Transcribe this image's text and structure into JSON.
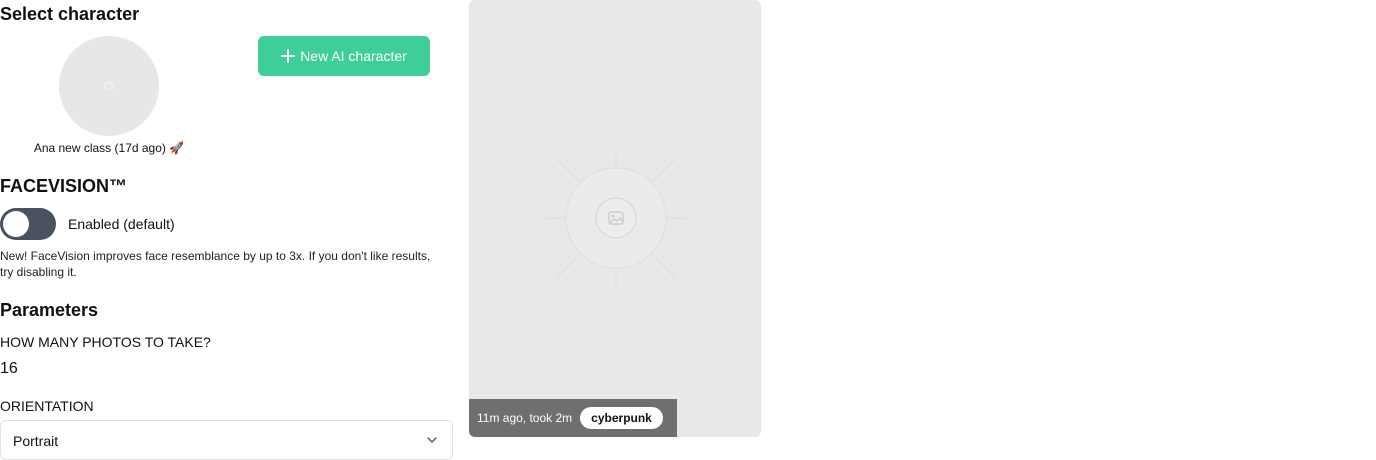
{
  "character_section": {
    "title": "Select character",
    "characters": [
      {
        "caption": "Ana new class (17d ago) 🚀"
      }
    ],
    "new_button_label": "New AI character"
  },
  "facevision": {
    "title": "FACEVISION™",
    "toggle_label": "Enabled (default)",
    "toggle_on": false,
    "description": "New! FaceVision improves face resemblance by up to 3x. If you don't like results, try disabling it."
  },
  "parameters": {
    "title": "Parameters",
    "photo_count_label": "HOW MANY PHOTOS TO TAKE?",
    "photo_count": "16",
    "orientation_label": "ORIENTATION",
    "orientation_value": "Portrait"
  },
  "preview": {
    "time_text": "11m ago, took 2m",
    "style_badge": "cyberpunk"
  },
  "colors": {
    "accent": "#3ecf99",
    "toggle_track": "#4a5160",
    "card_background": "#e8e8e8",
    "caption_bar": "#6f6f6f"
  },
  "icons": {
    "new_button": "plus-icon",
    "select": "chevron-down-icon",
    "preview_placeholder": "image-icon"
  }
}
